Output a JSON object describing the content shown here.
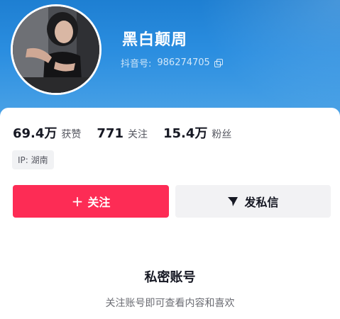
{
  "profile": {
    "nickname": "黑白颠周",
    "account_label": "抖音号:",
    "account_id": "986274705",
    "avatar_icon": "profile-photo",
    "copy_icon": "copy-icon"
  },
  "stats": [
    {
      "value": "69.4万",
      "label": "获赞"
    },
    {
      "value": "771",
      "label": "关注"
    },
    {
      "value": "15.4万",
      "label": "粉丝"
    }
  ],
  "ip_location": "IP: 湖南",
  "actions": {
    "follow_icon": "+",
    "follow_label": "关注",
    "message_icon": "send-icon",
    "message_label": "发私信"
  },
  "private_notice": {
    "title": "私密账号",
    "subtitle": "关注账号即可查看内容和喜欢"
  },
  "colors": {
    "header_blue": "#2b8ee0",
    "follow_red": "#fd2c55",
    "text_dark": "#161823",
    "tag_bg": "#f1f2f4"
  }
}
